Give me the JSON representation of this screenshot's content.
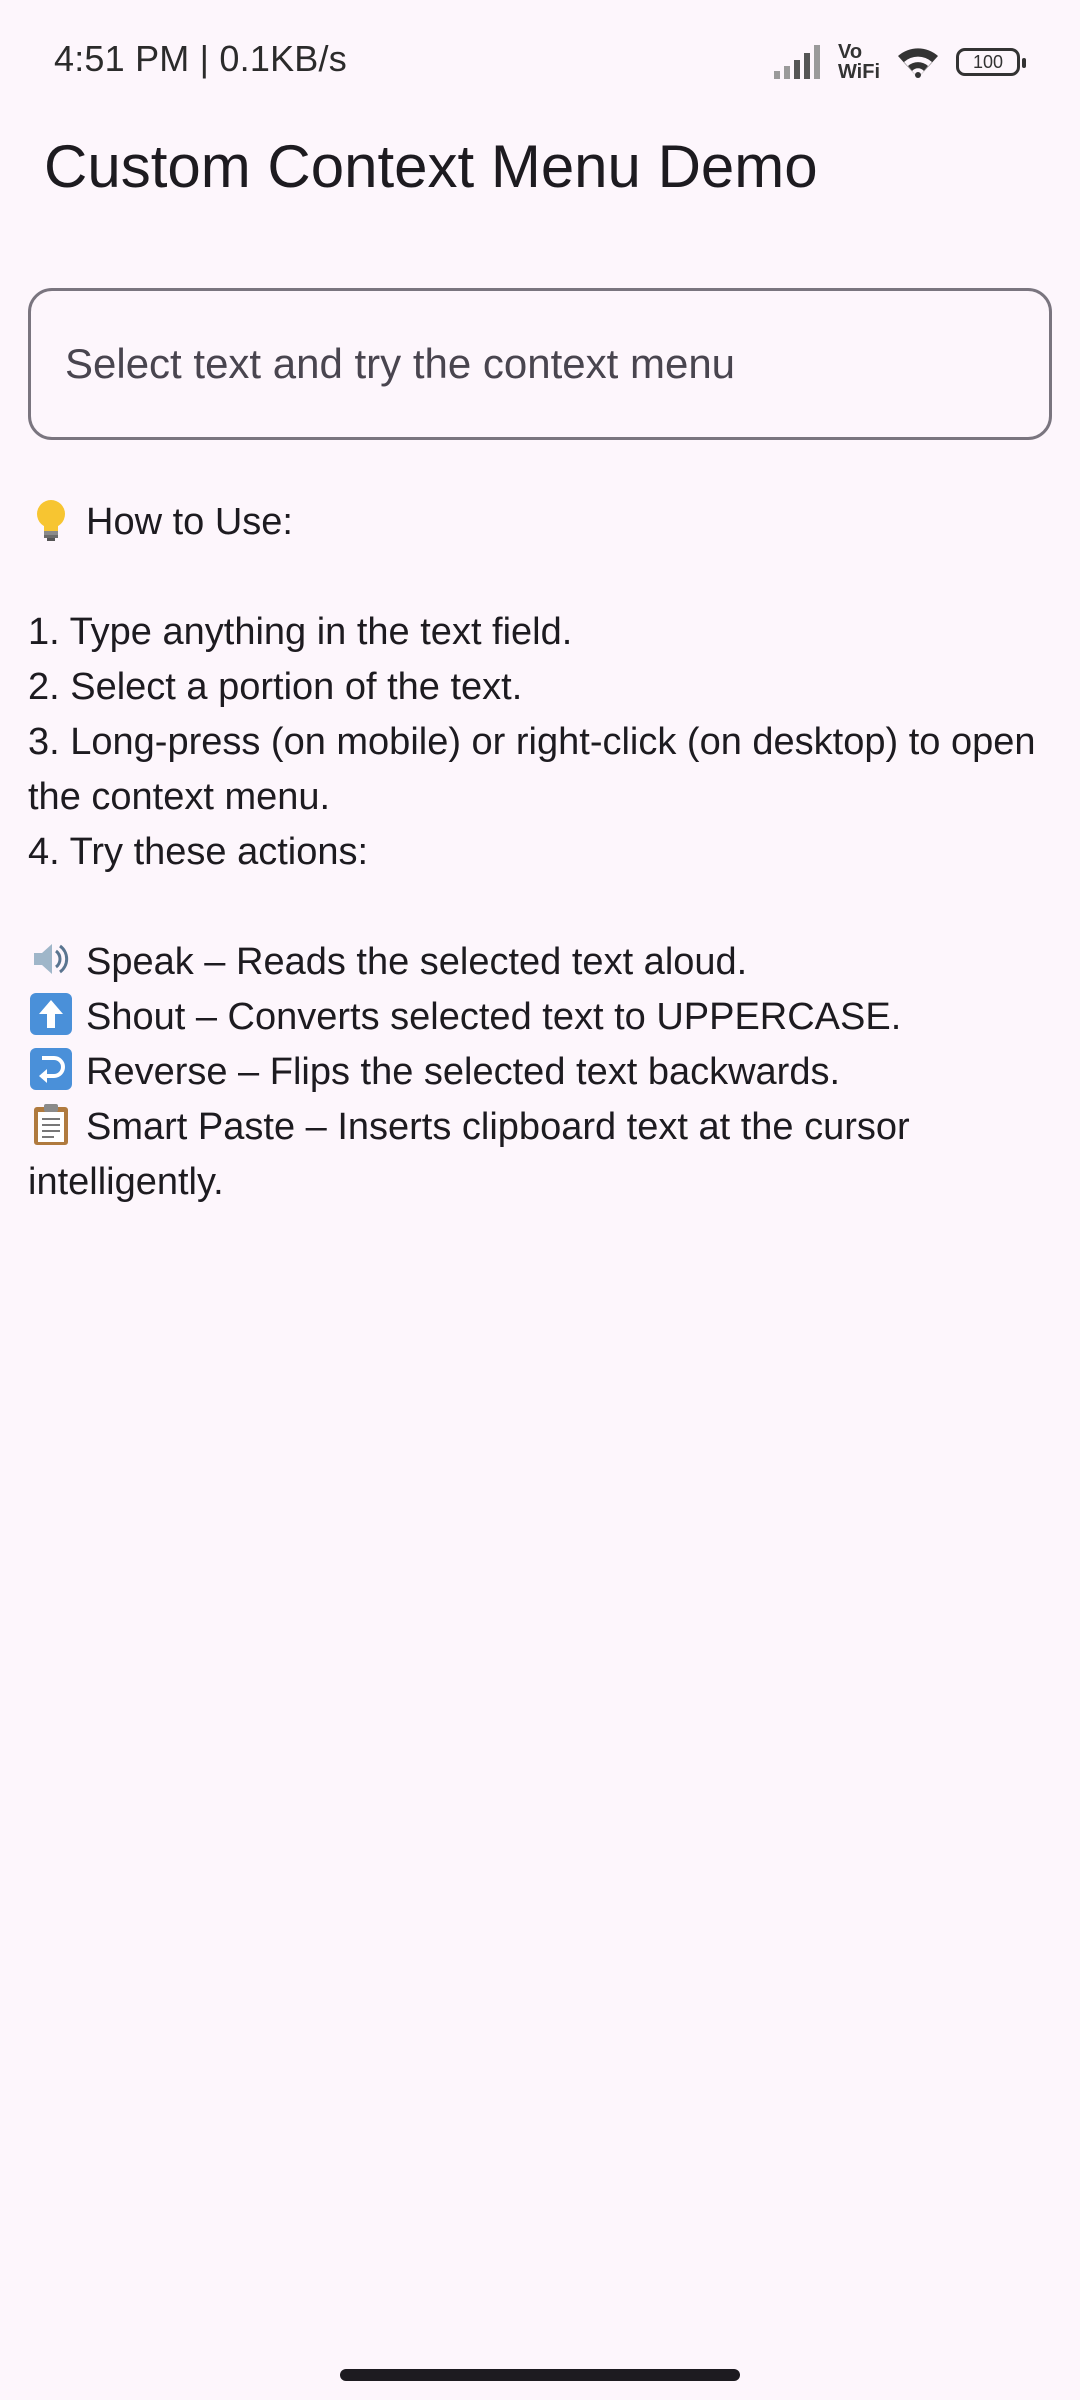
{
  "status_bar": {
    "time_and_speed": "4:51 PM | 0.1KB/s",
    "vowifi_top": "Vo",
    "vowifi_bottom": "WiFi",
    "battery": "100"
  },
  "app_bar": {
    "title": "Custom Context Menu Demo"
  },
  "text_field": {
    "placeholder": "Select text and try the context menu",
    "value": ""
  },
  "instructions": {
    "heading": "How to Use:",
    "steps": [
      "1. Type anything in the text field.",
      "2. Select a portion of the text.",
      "3. Long-press (on mobile) or right-click (on desktop) to open the context menu.",
      "4. Try these actions:"
    ],
    "actions": [
      {
        "icon": "speaker-icon",
        "text": "Speak – Reads the selected text aloud."
      },
      {
        "icon": "up-arrow-icon",
        "text": "Shout – Converts selected text to UPPERCASE."
      },
      {
        "icon": "return-arrow-icon",
        "text": "Reverse – Flips the selected text backwards."
      },
      {
        "icon": "clipboard-icon",
        "text": "Smart Paste – Inserts clipboard text at the cursor intelligently."
      }
    ]
  },
  "colors": {
    "background": "#fdf6fc",
    "text": "#1d1b20",
    "outline": "#7a757f",
    "emoji_blue": "#4a90d9"
  }
}
